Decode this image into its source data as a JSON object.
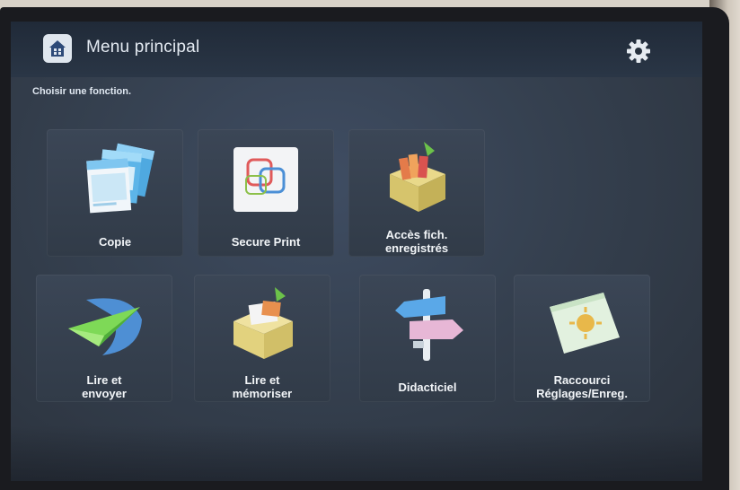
{
  "header": {
    "title": "Menu principal",
    "home_icon": "home-icon",
    "settings_icon": "gear-icon"
  },
  "subtitle": "Choisir une fonction.",
  "tiles": [
    {
      "label": "Copie",
      "icon": "copy-pages-icon"
    },
    {
      "label": "Secure Print",
      "icon": "secure-print-icon"
    },
    {
      "label": "Accès fich.\nenregistrés",
      "icon": "stored-files-box-icon"
    },
    {
      "label": "Lire et\nenvoyer",
      "icon": "paper-plane-icon"
    },
    {
      "label": "Lire et\nmémoriser",
      "icon": "store-box-icon"
    },
    {
      "label": "Didacticiel",
      "icon": "signpost-icon"
    },
    {
      "label": "Raccourci\nRéglages/Enreg.",
      "icon": "settings-shortcut-icon"
    }
  ],
  "colors": {
    "screen_bg": "#35404f",
    "header_bg": "#202a38",
    "tile_bg": "#3b4656",
    "text": "#f2f5f8"
  }
}
